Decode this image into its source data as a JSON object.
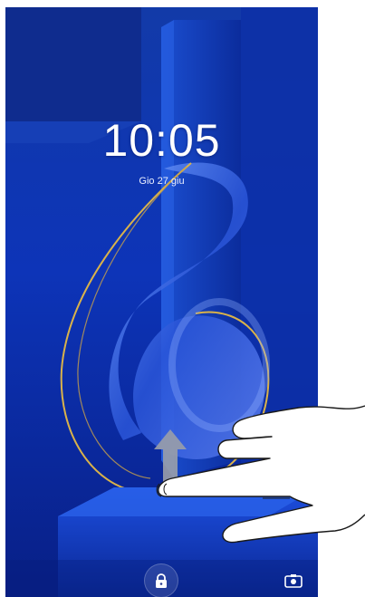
{
  "lockscreen": {
    "time": "10:05",
    "date": "Gio 27 giu"
  },
  "icons": {
    "lock": "lock-icon",
    "camera": "camera-icon",
    "swipe_up": "arrow-up-icon",
    "hand": "hand-gesture-icon"
  },
  "colors": {
    "background": "#0a2a9c",
    "accent_gold": "#d9b24a"
  }
}
